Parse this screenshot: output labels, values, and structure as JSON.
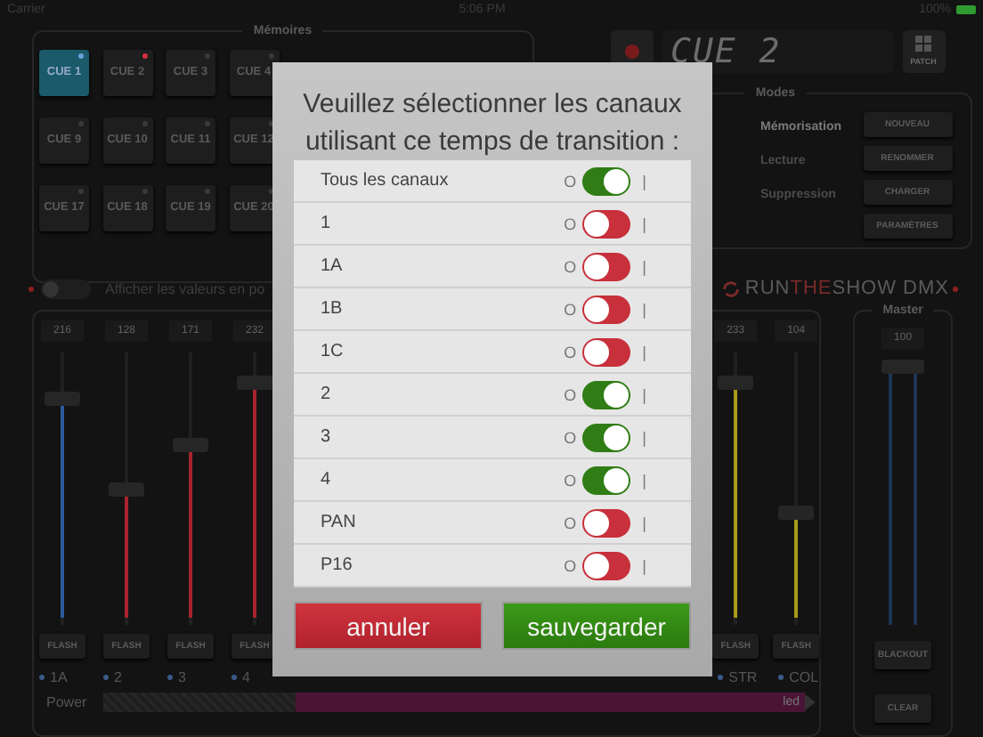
{
  "status_bar": {
    "carrier": "Carrier",
    "time": "5:06 PM",
    "battery": "100%"
  },
  "memories": {
    "title": "Mémoires",
    "cues": [
      {
        "label": "CUE 1",
        "selected": true,
        "color": "#6aa0d8"
      },
      {
        "label": "CUE 2",
        "selected": false,
        "color": "#d03040"
      },
      {
        "label": "CUE 3",
        "selected": false,
        "color": "#3a3a3a"
      },
      {
        "label": "CUE 4",
        "selected": false,
        "color": "#3a3a3a"
      },
      {
        "label": "CUE 9",
        "selected": false,
        "color": "#3a3a3a"
      },
      {
        "label": "CUE 10",
        "selected": false,
        "color": "#3a3a3a"
      },
      {
        "label": "CUE 11",
        "selected": false,
        "color": "#3a3a3a"
      },
      {
        "label": "CUE 12",
        "selected": false,
        "color": "#3a3a3a"
      },
      {
        "label": "CUE 17",
        "selected": false,
        "color": "#3a3a3a"
      },
      {
        "label": "CUE 18",
        "selected": false,
        "color": "#3a3a3a"
      },
      {
        "label": "CUE 19",
        "selected": false,
        "color": "#3a3a3a"
      },
      {
        "label": "CUE 20",
        "selected": false,
        "color": "#3a3a3a"
      }
    ]
  },
  "display": {
    "text": "CUE 2"
  },
  "patch_button": "PATCH",
  "modes": {
    "title": "Modes",
    "items": [
      {
        "label": "Mémorisation",
        "selected": true
      },
      {
        "label": "Lecture",
        "selected": false
      },
      {
        "label": "Suppression",
        "selected": false
      }
    ],
    "buttons": [
      "NOUVEAU",
      "RENOMMER",
      "CHARGER",
      "PARAMÈTRES"
    ]
  },
  "show_values": {
    "label": "Afficher les valeurs en po",
    "on": false
  },
  "logo": {
    "part_1": "RUN",
    "part_2": "THE",
    "part_3": "SHOW DMX"
  },
  "faders_left": [
    {
      "value": "216",
      "level": 0.85,
      "color": "#2c5a9c",
      "flash": "FLASH",
      "label": "1A"
    },
    {
      "value": "128",
      "level": 0.5,
      "color": "#a8242c",
      "flash": "FLASH",
      "label": "2"
    },
    {
      "value": "171",
      "level": 0.67,
      "color": "#a8242c",
      "flash": "FLASH",
      "label": "3"
    },
    {
      "value": "232",
      "level": 0.91,
      "color": "#a8242c",
      "flash": "FLASH",
      "label": "4"
    }
  ],
  "faders_right": [
    {
      "value": "233",
      "level": 0.91,
      "color": "#a89a1a",
      "flash": "FLASH",
      "label": "STR"
    },
    {
      "value": "104",
      "level": 0.41,
      "color": "#a89a1a",
      "flash": "FLASH",
      "label": "COL"
    }
  ],
  "power": {
    "label": "Power",
    "value": "led"
  },
  "master": {
    "title": "Master",
    "value": "100",
    "level": 1,
    "buttons": [
      "BLACKOUT",
      "CLEAR"
    ]
  },
  "dialog": {
    "title": "Veuillez sélectionner les canaux utilisant ce temps de transition :",
    "channels": [
      {
        "name": "Tous les canaux",
        "on": true,
        "off_label": "O",
        "on_label": "|"
      },
      {
        "name": "1",
        "on": false,
        "off_label": "O",
        "on_label": "|"
      },
      {
        "name": "1A",
        "on": false,
        "off_label": "O",
        "on_label": "|"
      },
      {
        "name": "1B",
        "on": false,
        "off_label": "O",
        "on_label": "|"
      },
      {
        "name": "1C",
        "on": false,
        "off_label": "O",
        "on_label": "|"
      },
      {
        "name": "2",
        "on": true,
        "off_label": "O",
        "on_label": "|"
      },
      {
        "name": "3",
        "on": true,
        "off_label": "O",
        "on_label": "|"
      },
      {
        "name": "4",
        "on": true,
        "off_label": "O",
        "on_label": "|"
      },
      {
        "name": "PAN",
        "on": false,
        "off_label": "O",
        "on_label": "|"
      },
      {
        "name": "P16",
        "on": false,
        "off_label": "O",
        "on_label": "|"
      }
    ],
    "cancel": "annuler",
    "save": "sauvegarder"
  }
}
